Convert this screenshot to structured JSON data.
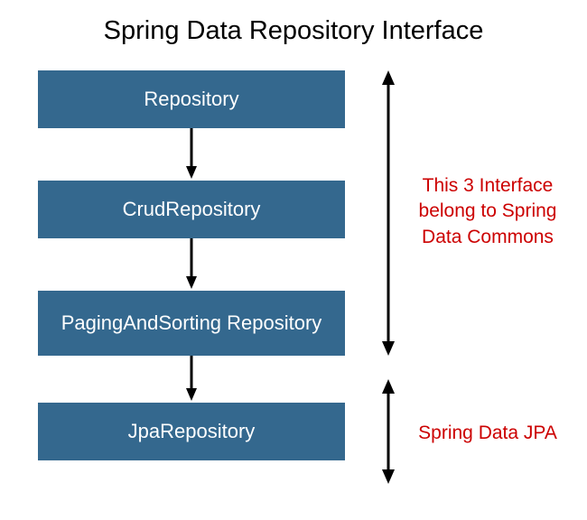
{
  "title": "Spring Data Repository Interface",
  "boxes": {
    "b1": "Repository",
    "b2": "CrudRepository",
    "b3": "PagingAndSorting Repository",
    "b4": "JpaRepository"
  },
  "annotations": {
    "group1": "This 3 Interface belong to Spring Data Commons",
    "group2": "Spring Data JPA"
  },
  "colors": {
    "boxFill": "#34688e",
    "boxText": "#ffffff",
    "annotation": "#cc0000"
  }
}
